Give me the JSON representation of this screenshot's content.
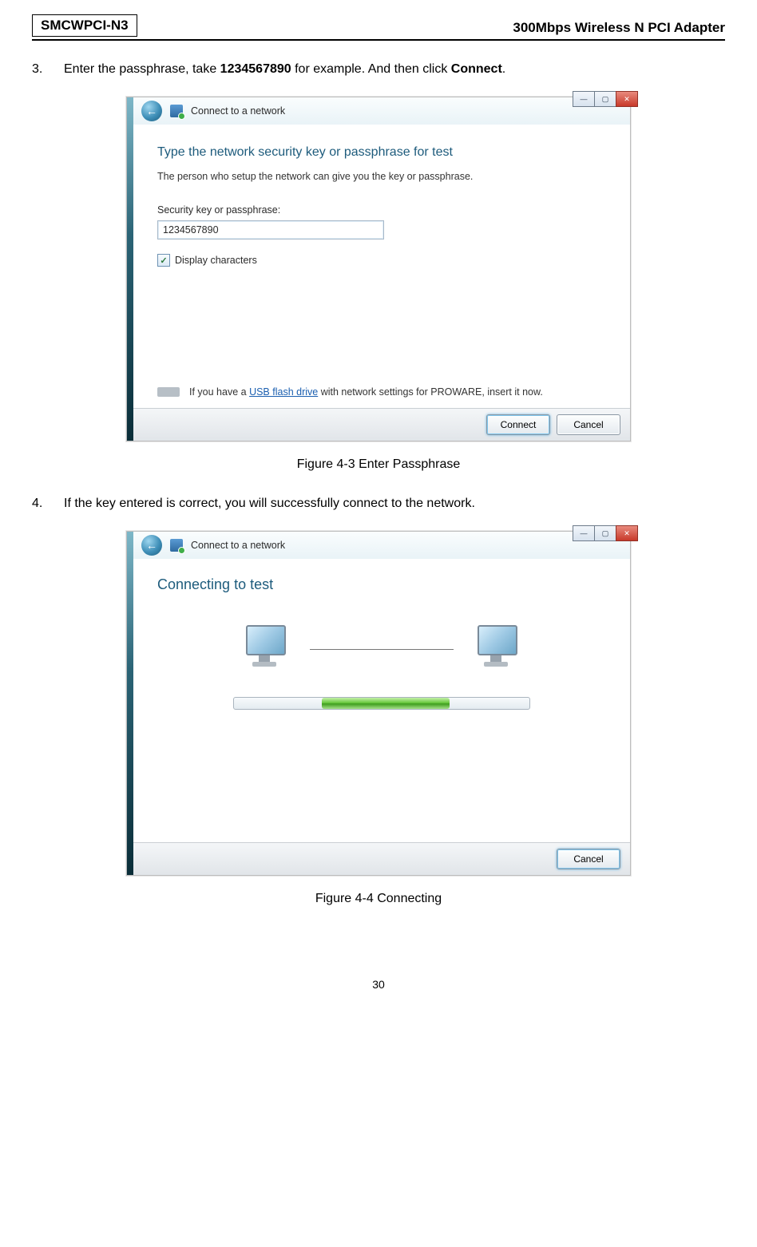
{
  "header": {
    "model": "SMCWPCI-N3",
    "product": "300Mbps Wireless N PCI Adapter"
  },
  "steps": {
    "s3": {
      "num": "3.",
      "pre": "Enter the passphrase, take ",
      "ex": "1234567890",
      "mid": " for example. And then click ",
      "action": "Connect",
      "post": "."
    },
    "s4": {
      "num": "4.",
      "text": "If the key entered is correct, you will successfully connect to the network."
    }
  },
  "win": {
    "min": "—",
    "max": "▢",
    "close": "✕",
    "back": "←"
  },
  "dlg1": {
    "title": "Connect to a network",
    "heading_pre": "Type the network security key or passphrase for ",
    "heading_net": "test",
    "sub": "The person who setup the network can give you the key or passphrase.",
    "field_label": "Security key or passphrase:",
    "field_value": "1234567890",
    "chk_label": "Display characters",
    "chk_state": "✓",
    "usb_pre": "If you have a ",
    "usb_link": "USB flash drive",
    "usb_post": " with network settings for PROWARE, insert it now.",
    "btn_primary": "Connect",
    "btn_cancel": "Cancel"
  },
  "dlg2": {
    "title": "Connect to a network",
    "heading": "Connecting to test",
    "btn_cancel": "Cancel"
  },
  "fig": {
    "f1": "Figure 4-3 Enter Passphrase",
    "f2": "Figure 4-4 Connecting"
  },
  "page_number": "30"
}
